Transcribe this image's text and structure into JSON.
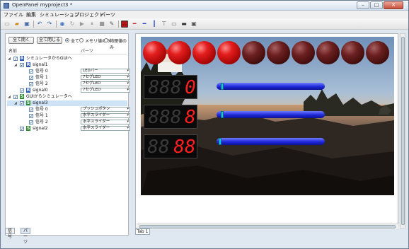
{
  "window": {
    "title": "OpenPanel myproject3 *"
  },
  "menu": [
    "ファイル",
    "編集",
    "シミュレーション",
    "プロジェクト",
    "パーツ"
  ],
  "toolbar_icons": [
    "new-icon",
    "open-icon",
    "save-icon",
    "undo-icon",
    "redo-icon",
    "stop-icon",
    "refresh-icon",
    "play-icon",
    "pause-icon",
    "step-icon",
    "build-icon",
    "lamp-part-icon",
    "slider-part-icon",
    "slider-part-icon",
    "push-button-part-icon",
    "toggle-part-icon",
    "frame-part-icon",
    "image-part-icon"
  ],
  "left": {
    "expand_all": "全て開く",
    "collapse_all": "全て閉じる",
    "filter_all": "全て",
    "filter_memory": "メモリ値のみ",
    "filter_physical": "物理値のみ",
    "col_name": "名前",
    "col_parts": "パーツ",
    "tree": [
      {
        "label": "シミュレータからGUIへ",
        "icon": "R",
        "level": 0
      },
      {
        "label": "signal1",
        "icon": "R",
        "level": 1
      },
      {
        "label": "信号 0",
        "level": 2,
        "part": "LEDバー"
      },
      {
        "label": "信号 1",
        "level": 2,
        "part": "7セグLED"
      },
      {
        "label": "信号 2",
        "level": 2,
        "part": "7セグLED"
      },
      {
        "label": "signal0",
        "icon": "R",
        "level": 1,
        "part": "7セグLED"
      },
      {
        "label": "GUIからシミュレータへ",
        "icon": "S",
        "level": 0
      },
      {
        "label": "signal3",
        "icon": "S",
        "level": 1
      },
      {
        "label": "信号 0",
        "level": 2,
        "part": "プッシュボタン"
      },
      {
        "label": "信号 1",
        "level": 2,
        "part": "水平スライダー"
      },
      {
        "label": "信号 2",
        "level": 2,
        "part": "水平スライダー"
      },
      {
        "label": "signal2",
        "icon": "S",
        "level": 1,
        "part": "水平スライダー"
      }
    ]
  },
  "bottom_tabs": [
    "信号",
    "パーツ"
  ],
  "canvas_tab": "Tab 1",
  "displays": [
    {
      "off_digits": "888",
      "on_digits": "0"
    },
    {
      "off_digits": "888",
      "on_digits": "8"
    },
    {
      "off_digits": "88",
      "on_digits": "88"
    }
  ],
  "lamps": [
    true,
    true,
    true,
    true,
    false,
    false,
    false,
    false,
    false,
    false
  ],
  "sliders": [
    0.04,
    0.04,
    0.02
  ],
  "colors": {
    "lamp_on": "#e31e1e",
    "lamp_off": "#3c0a0a",
    "slider": "#1d28d8",
    "segment": "#ff1f1f"
  }
}
